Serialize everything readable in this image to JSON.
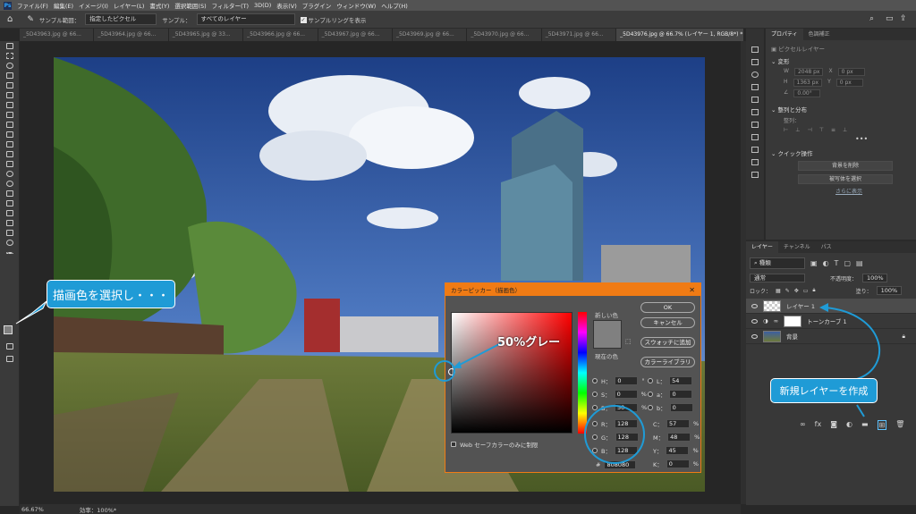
{
  "app": {
    "logo": "Ps"
  },
  "menu": [
    "ファイル(F)",
    "編集(E)",
    "イメージ(I)",
    "レイヤー(L)",
    "書式(Y)",
    "選択範囲(S)",
    "フィルター(T)",
    "3D(D)",
    "表示(V)",
    "プラグイン",
    "ウィンドウ(W)",
    "ヘルプ(H)"
  ],
  "options": {
    "sample_size_label": "サンプル範囲：",
    "sample_size_value": "指定したピクセル",
    "sample_label": "サンプル：",
    "sample_value": "すべてのレイヤー",
    "ring_label": "サンプルリングを表示"
  },
  "tabs": [
    "_5D43963.jpg @ 66...",
    "_5D43964.jpg @ 66...",
    "_5D43965.jpg @ 33...",
    "_5D43966.jpg @ 66...",
    "_5D43967.jpg @ 66...",
    "_5D43969.jpg @ 66...",
    "_5D43970.jpg @ 66...",
    "_5D43971.jpg @ 66...",
    "_5D43976.jpg @ 66.7% (レイヤー 1, RGB/8*) *"
  ],
  "status": {
    "zoom": "66.67%",
    "efficiency": "効率：100%*"
  },
  "properties": {
    "tabs": [
      "プロパティ",
      "色調補正"
    ],
    "layer_kind": "ピクセルレイヤー",
    "transform_title": "変形",
    "w_label": "W",
    "w_value": "2048 px",
    "x_label": "X",
    "x_value": "0 px",
    "h_label": "H",
    "h_value": "1363 px",
    "y_label": "Y",
    "y_value": "0 px",
    "angle": "0.00°",
    "align_title": "整列と分布",
    "align_sub": "整列：",
    "quick_title": "クイック操作",
    "btn_remove_bg": "背景を削除",
    "btn_select_subject": "被写体を選択",
    "more": "さらに表示"
  },
  "layers": {
    "tabs": [
      "レイヤー",
      "チャンネル",
      "パス"
    ],
    "kind": "種類",
    "blend": "通常",
    "opacity_label": "不透明度：",
    "opacity": "100%",
    "lock_label": "ロック：",
    "fill_label": "塗り：",
    "fill": "100%",
    "items": [
      {
        "name": "レイヤー 1"
      },
      {
        "name": "トーンカーブ 1"
      },
      {
        "name": "背景"
      }
    ]
  },
  "dialog": {
    "title": "カラーピッカー（描画色）",
    "new_label": "新しい色",
    "current_label": "現在の色",
    "ok": "OK",
    "cancel": "キャンセル",
    "add_swatch": "スウォッチに追加",
    "library": "カラーライブラリ",
    "h_label": "H：",
    "h_value": "0",
    "h_unit": "°",
    "s_label": "S：",
    "s_value": "0",
    "s_unit": "%",
    "b_label": "B：",
    "b_value": "50",
    "b_unit": "%",
    "r_label": "R：",
    "r_value": "128",
    "g_label": "G：",
    "g_value": "128",
    "bl_label": "B：",
    "bl_value": "128",
    "l_label": "L：",
    "l_value": "54",
    "a_label": "a：",
    "a_value": "0",
    "lb_label": "b：",
    "lb_value": "0",
    "c_label": "C：",
    "c_value": "57",
    "c_unit": "%",
    "m_label": "M：",
    "m_value": "48",
    "m_unit": "%",
    "y_label": "Y：",
    "y_value": "45",
    "y_unit": "%",
    "k_label": "K：",
    "k_value": "0",
    "k_unit": "%",
    "hex_label": "#",
    "hex_value": "808080",
    "web_only": "Web セーフカラーのみに制限",
    "new_color": "#808080",
    "current_color": "#808080"
  },
  "callouts": {
    "select_color": "描画色を選択し・・・",
    "gray50": "50%グレー",
    "new_layer": "新規レイヤーを作成"
  },
  "colors": {
    "accent": "#1f9bd6",
    "dialog_border": "#f07b14",
    "gray": "#808080"
  }
}
